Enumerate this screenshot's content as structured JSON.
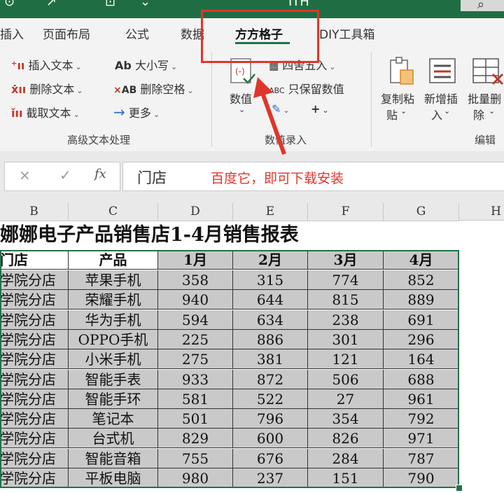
{
  "app": {
    "title_fragment": "ITH",
    "accent_color": "#217346",
    "annotation_color": "#e0352b"
  },
  "tabs": [
    {
      "label": "插入"
    },
    {
      "label": "页面布局"
    },
    {
      "label": "公式"
    },
    {
      "label": "数据"
    },
    {
      "label": "方方格子",
      "active": true
    },
    {
      "label": "DIY工具箱"
    }
  ],
  "ribbon": {
    "text_group": {
      "insert_text": "插入文本",
      "delete_text": "删除文本",
      "cut_text": "截取文本",
      "case": "大小写",
      "remove_spaces": "删除空格",
      "more": "更多",
      "label": "高级文本处理"
    },
    "number_group": {
      "value_button": "数值",
      "round": "四舍五入",
      "keep_numbers": "只保留数值",
      "label": "数值录入"
    },
    "edit_group": {
      "copy_paste_1": "复制粘",
      "copy_paste_2": "贴",
      "new_insert_1": "新增插",
      "new_insert_2": "入",
      "batch_delete_1": "批量删",
      "batch_delete_2": "除",
      "label": "编辑"
    }
  },
  "formula_bar": {
    "name_box": "门店",
    "annotation": "百度它，即可下载安装",
    "fx": "fx"
  },
  "columns": [
    "B",
    "C",
    "D",
    "E",
    "F",
    "G",
    "H"
  ],
  "sheet": {
    "title": "娜娜电子产品销售店1-4月销售报表",
    "headers": [
      "门店",
      "产品",
      "1月",
      "2月",
      "3月",
      "4月"
    ],
    "rows": [
      [
        "学院分店",
        "苹果手机",
        "358",
        "315",
        "774",
        "852"
      ],
      [
        "学院分店",
        "荣耀手机",
        "940",
        "644",
        "815",
        "889"
      ],
      [
        "学院分店",
        "华为手机",
        "594",
        "634",
        "238",
        "691"
      ],
      [
        "学院分店",
        "OPPO手机",
        "225",
        "886",
        "301",
        "296"
      ],
      [
        "学院分店",
        "小米手机",
        "275",
        "381",
        "121",
        "164"
      ],
      [
        "学院分店",
        "智能手表",
        "933",
        "872",
        "506",
        "688"
      ],
      [
        "学院分店",
        "智能手环",
        "581",
        "522",
        "27",
        "961"
      ],
      [
        "学院分店",
        "笔记本",
        "501",
        "796",
        "354",
        "792"
      ],
      [
        "学院分店",
        "台式机",
        "829",
        "600",
        "826",
        "971"
      ],
      [
        "学院分店",
        "智能音箱",
        "755",
        "676",
        "284",
        "787"
      ],
      [
        "学院分店",
        "平板电脑",
        "980",
        "237",
        "151",
        "790"
      ]
    ]
  }
}
